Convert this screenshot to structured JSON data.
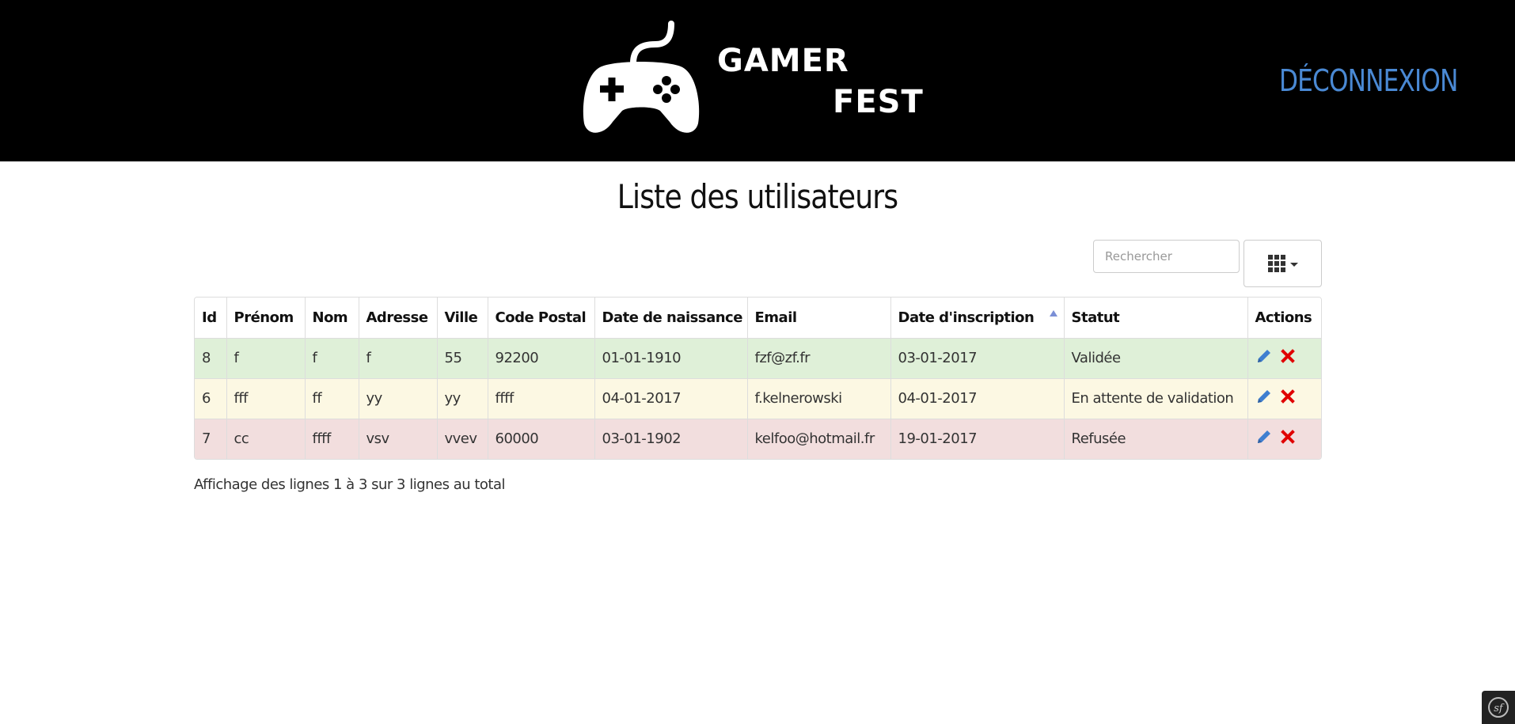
{
  "header": {
    "logo_line1": "GAMER",
    "logo_line2": "FEST",
    "logout_label": "DÉCONNEXION",
    "background": "#000000",
    "link_color": "#4a89d4"
  },
  "page": {
    "title": "Liste des utilisateurs"
  },
  "toolbar": {
    "search_placeholder": "Rechercher",
    "columns_icon": "grid-icon"
  },
  "table": {
    "columns": [
      "Id",
      "Prénom",
      "Nom",
      "Adresse",
      "Ville",
      "Code Postal",
      "Date de naissance",
      "Email",
      "Date d'inscription",
      "Statut",
      "Actions"
    ],
    "sorted_column": "Date d'inscription",
    "sort_direction": "ascending",
    "rows": [
      {
        "status_class": "success",
        "cells": [
          "8",
          "f",
          "f",
          "f",
          "55",
          "92200",
          "01-01-1910",
          "fzf@zf.fr",
          "03-01-2017",
          "Validée"
        ]
      },
      {
        "status_class": "warning",
        "cells": [
          "6",
          "fff",
          "ff",
          "yy",
          "yy",
          "ffff",
          "04-01-2017",
          "f.kelnerowski",
          "04-01-2017",
          "En attente de validation"
        ]
      },
      {
        "status_class": "danger",
        "cells": [
          "7",
          "cc",
          "ffff",
          "vsv",
          "vvev",
          "60000",
          "03-01-1902",
          "kelfoo@hotmail.fr",
          "19-01-2017",
          "Refusée"
        ]
      }
    ],
    "row_colors": {
      "success": "#dff0d8",
      "warning": "#fcf8e3",
      "danger": "#f2dede"
    },
    "actions": [
      "pencil-icon",
      "delete-x-icon"
    ]
  },
  "footer": {
    "info": "Affichage des lignes 1 à 3 sur 3 lignes au total"
  },
  "debug_badge": {
    "icon": "symfony-icon"
  }
}
